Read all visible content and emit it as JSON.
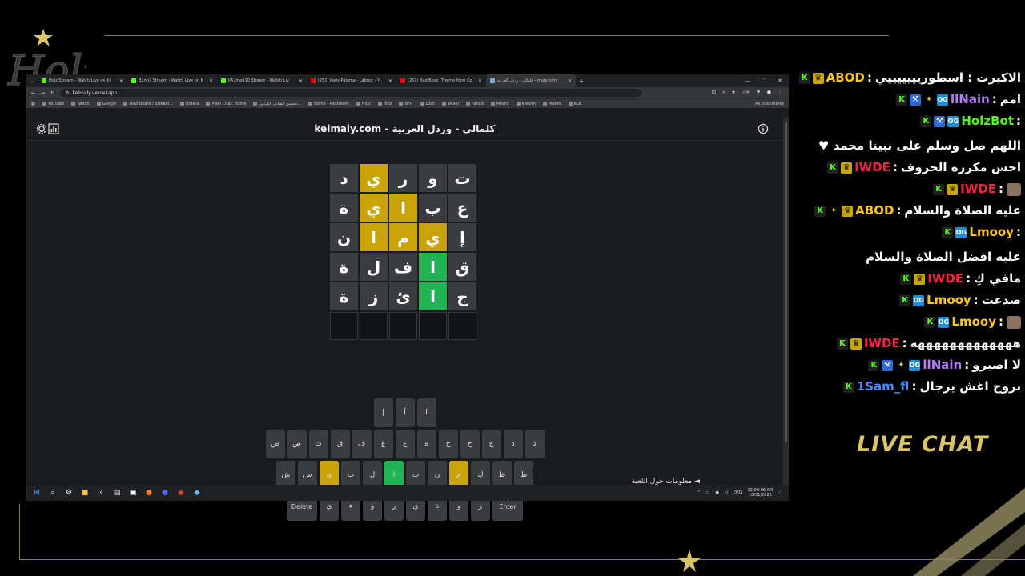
{
  "browser": {
    "tabs": [
      {
        "title": "Holz Stream - Watch Live on Ki",
        "icon": "kick-icon",
        "color": "#53fc18"
      },
      {
        "title": "B2ng7 Stream - Watch Live on K",
        "icon": "kick-icon",
        "color": "#53fc18"
      },
      {
        "title": "llA7med10 Stream - Watch Liv",
        "icon": "kick-icon",
        "color": "#53fc18"
      },
      {
        "title": "(251) Paris Paloma - Labour - Y",
        "icon": "youtube-icon",
        "color": "#ff0000"
      },
      {
        "title": "(251) Bad Boys (Theme from Co",
        "icon": "youtube-icon",
        "color": "#ff0000"
      },
      {
        "title": "كلمالي - وردل العربية - maly.com",
        "icon": "globe-icon",
        "color": "#7aa7d6",
        "active": true
      }
    ],
    "url": "kelmaly.vercel.app",
    "bookmarks": [
      "YouTube",
      "Twitch",
      "Google",
      "Dashboard / Stream...",
      "BotRix",
      "Pixel Chat: Home",
      "تحسين انشاني الكرتون...",
      "Home - Restream",
      "Holz",
      "Holz",
      "NFR",
      "Loch",
      "ak90l",
      "Fahad",
      "Meshz",
      "Kwerm",
      "Mueth",
      "BLB"
    ],
    "all_bookmarks": "All Bookmarks"
  },
  "game": {
    "title": "kelmaly.com - كلمالي - وردل العربية",
    "board": [
      [
        {
          "l": "ت",
          "s": "absent"
        },
        {
          "l": "و",
          "s": "absent"
        },
        {
          "l": "ر",
          "s": "absent"
        },
        {
          "l": "ي",
          "s": "present"
        },
        {
          "l": "د",
          "s": "absent"
        }
      ],
      [
        {
          "l": "ع",
          "s": "absent"
        },
        {
          "l": "ب",
          "s": "absent"
        },
        {
          "l": "ا",
          "s": "present"
        },
        {
          "l": "ي",
          "s": "present"
        },
        {
          "l": "ة",
          "s": "absent"
        }
      ],
      [
        {
          "l": "إ",
          "s": "absent"
        },
        {
          "l": "ي",
          "s": "present"
        },
        {
          "l": "م",
          "s": "present"
        },
        {
          "l": "ا",
          "s": "present"
        },
        {
          "l": "ن",
          "s": "absent"
        }
      ],
      [
        {
          "l": "ق",
          "s": "absent"
        },
        {
          "l": "ا",
          "s": "correct"
        },
        {
          "l": "ف",
          "s": "absent"
        },
        {
          "l": "ل",
          "s": "absent"
        },
        {
          "l": "ة",
          "s": "absent"
        }
      ],
      [
        {
          "l": "ج",
          "s": "absent"
        },
        {
          "l": "ا",
          "s": "correct"
        },
        {
          "l": "ئ",
          "s": "absent"
        },
        {
          "l": "ز",
          "s": "absent"
        },
        {
          "l": "ة",
          "s": "absent"
        }
      ],
      [
        {
          "l": "",
          "s": "empty"
        },
        {
          "l": "",
          "s": "empty"
        },
        {
          "l": "",
          "s": "empty"
        },
        {
          "l": "",
          "s": "empty"
        },
        {
          "l": "",
          "s": "empty"
        }
      ]
    ],
    "keyboard": [
      [
        {
          "k": "ا"
        },
        {
          "k": "آ"
        },
        {
          "k": "إ"
        }
      ],
      [
        {
          "k": "ذ"
        },
        {
          "k": "د"
        },
        {
          "k": "ج"
        },
        {
          "k": "ح"
        },
        {
          "k": "خ"
        },
        {
          "k": "ه"
        },
        {
          "k": "ع"
        },
        {
          "k": "غ"
        },
        {
          "k": "ف"
        },
        {
          "k": "ق"
        },
        {
          "k": "ث"
        },
        {
          "k": "ص"
        },
        {
          "k": "ض"
        }
      ],
      [
        {
          "k": "ط"
        },
        {
          "k": "ظ"
        },
        {
          "k": "ك"
        },
        {
          "k": "م",
          "s": "present"
        },
        {
          "k": "ن"
        },
        {
          "k": "ت"
        },
        {
          "k": "ا",
          "s": "correct"
        },
        {
          "k": "ل"
        },
        {
          "k": "ب"
        },
        {
          "k": "ي",
          "s": "present"
        },
        {
          "k": "س"
        },
        {
          "k": "ش"
        }
      ],
      [
        {
          "k": "Enter",
          "wide": true
        },
        {
          "k": "ز"
        },
        {
          "k": "و"
        },
        {
          "k": "ة"
        },
        {
          "k": "ى"
        },
        {
          "k": "ر"
        },
        {
          "k": "ؤ"
        },
        {
          "k": "ء"
        },
        {
          "k": "ئ"
        },
        {
          "k": "Delete",
          "wide": true
        }
      ]
    ],
    "info_link": "معلومات حول اللعبة ◄",
    "colors": {
      "present": "#c9a409",
      "correct": "#22b357",
      "absent": "#3a3c40"
    }
  },
  "taskbar": {
    "lang": "ENG",
    "time": "12:00:06 AM",
    "date": "10/31/2025"
  },
  "chat": {
    "messages": [
      {
        "user": "ABOD",
        "color": "#ffc61a",
        "badges": [
          "kick",
          "crown"
        ],
        "text": "الاكبرت : اسطوريييييييي"
      },
      {
        "user": "llNain",
        "color": "#b57cff",
        "badges": [
          "kick",
          "mod",
          "star",
          "og"
        ],
        "text": "امم"
      },
      {
        "user": "HolzBot",
        "color": "#53fc18",
        "badges": [
          "kick",
          "mod",
          "og"
        ],
        "text": "اللهم صل وسلم على نبينا محمد ♥"
      },
      {
        "user": "IWDE",
        "color": "#ff2244",
        "badges": [
          "kick",
          "crown"
        ],
        "text": "احس مكرره الحروف"
      },
      {
        "user": "IWDE",
        "color": "#ff2244",
        "badges": [
          "kick",
          "crown"
        ],
        "text": "",
        "emote": true
      },
      {
        "user": "ABOD",
        "color": "#ffc61a",
        "badges": [
          "kick",
          "star",
          "crown"
        ],
        "text": "عليه الصلاة والسلام"
      },
      {
        "user": "Lmooy",
        "color": "#ffc61a",
        "badges": [
          "kick",
          "og"
        ],
        "text": "عليه افضل الصلاة والسلام"
      },
      {
        "user": "IWDE",
        "color": "#ff2244",
        "badges": [
          "kick",
          "crown"
        ],
        "text": "مافي كِ"
      },
      {
        "user": "Lmooy",
        "color": "#ffc61a",
        "badges": [
          "kick",
          "og"
        ],
        "text": "صدعت"
      },
      {
        "user": "Lmooy",
        "color": "#ffc61a",
        "badges": [
          "kick",
          "og"
        ],
        "text": "",
        "emote": true
      },
      {
        "user": "IWDE",
        "color": "#ff2244",
        "badges": [
          "kick",
          "crown"
        ],
        "text": "هههههههههههههه"
      },
      {
        "user": "llNain",
        "color": "#b57cff",
        "badges": [
          "kick",
          "mod",
          "star",
          "og"
        ],
        "text": "لا اصبرو"
      },
      {
        "user": "1Sam_fl",
        "color": "#4a8cff",
        "badges": [
          "kick"
        ],
        "text": "بروح اغش يرجال"
      }
    ]
  },
  "overlay": {
    "live_chat_label": "LIVE CHAT"
  }
}
